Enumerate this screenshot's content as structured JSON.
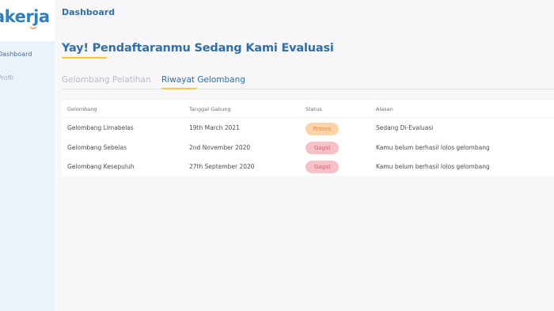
{
  "app": {
    "logo_text": "akerja"
  },
  "sidebar": {
    "items": [
      {
        "label": "Dashboard"
      },
      {
        "label": "Profil"
      }
    ]
  },
  "header": {
    "breadcrumb": "Dashboard"
  },
  "main": {
    "title": "Yay! Pendaftaranmu Sedang Kami Evaluasi",
    "tabs": [
      {
        "label": "Gelombang Pelatihan"
      },
      {
        "label": "Riwayat Gelombang",
        "active": true
      }
    ],
    "table": {
      "columns": [
        "Gelombang",
        "Tanggal Gabung",
        "Status",
        "Alasan"
      ],
      "rows": [
        {
          "gelombang": "Gelombang Limabelas",
          "tanggal": "19th March 2021",
          "status": "Proses",
          "alasan": "Sedang Di-Evaluasi"
        },
        {
          "gelombang": "Gelombang Sebelas",
          "tanggal": "2nd November 2020",
          "status": "Gagal",
          "alasan": "Kamu belum berhasil lolos gelombang"
        },
        {
          "gelombang": "Gelombang Kesepuluh",
          "tanggal": "27th September 2020",
          "status": "Gagal",
          "alasan": "Kamu belum berhasil lolos gelombang"
        }
      ]
    }
  },
  "colors": {
    "primary": "#2f6fab",
    "accent": "#f3c54a",
    "sidebar_bg": "#eaf2fc",
    "status_proses_bg": "#fbd3a8",
    "status_gagal_bg": "#f8c1c6"
  }
}
